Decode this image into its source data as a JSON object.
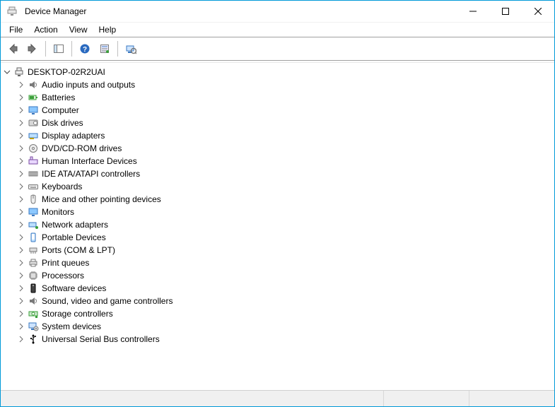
{
  "window": {
    "title": "Device Manager"
  },
  "menu": {
    "items": [
      "File",
      "Action",
      "View",
      "Help"
    ]
  },
  "toolbar": {
    "buttons": [
      {
        "name": "back-button",
        "icon": "arrow-left-icon"
      },
      {
        "name": "forward-button",
        "icon": "arrow-right-icon"
      },
      {
        "sep": true
      },
      {
        "name": "show-hide-tree-button",
        "icon": "tree-panel-icon"
      },
      {
        "sep": true
      },
      {
        "name": "help-button",
        "icon": "help-icon"
      },
      {
        "name": "properties-button",
        "icon": "properties-icon"
      },
      {
        "sep": true
      },
      {
        "name": "scan-hardware-button",
        "icon": "scan-icon"
      }
    ]
  },
  "tree": {
    "root": {
      "label": "DESKTOP-02R2UAI",
      "icon": "computer-icon",
      "expanded": true
    },
    "categories": [
      {
        "label": "Audio inputs and outputs",
        "icon": "audio-icon"
      },
      {
        "label": "Batteries",
        "icon": "battery-icon"
      },
      {
        "label": "Computer",
        "icon": "monitor-icon"
      },
      {
        "label": "Disk drives",
        "icon": "disk-icon"
      },
      {
        "label": "Display adapters",
        "icon": "display-adapter-icon"
      },
      {
        "label": "DVD/CD-ROM drives",
        "icon": "optical-drive-icon"
      },
      {
        "label": "Human Interface Devices",
        "icon": "hid-icon"
      },
      {
        "label": "IDE ATA/ATAPI controllers",
        "icon": "ide-icon"
      },
      {
        "label": "Keyboards",
        "icon": "keyboard-icon"
      },
      {
        "label": "Mice and other pointing devices",
        "icon": "mouse-icon"
      },
      {
        "label": "Monitors",
        "icon": "monitor-icon"
      },
      {
        "label": "Network adapters",
        "icon": "network-icon"
      },
      {
        "label": "Portable Devices",
        "icon": "portable-icon"
      },
      {
        "label": "Ports (COM & LPT)",
        "icon": "port-icon"
      },
      {
        "label": "Print queues",
        "icon": "printer-icon"
      },
      {
        "label": "Processors",
        "icon": "cpu-icon"
      },
      {
        "label": "Software devices",
        "icon": "software-icon"
      },
      {
        "label": "Sound, video and game controllers",
        "icon": "audio-icon"
      },
      {
        "label": "Storage controllers",
        "icon": "storage-icon"
      },
      {
        "label": "System devices",
        "icon": "system-icon"
      },
      {
        "label": "Universal Serial Bus controllers",
        "icon": "usb-icon"
      }
    ]
  }
}
